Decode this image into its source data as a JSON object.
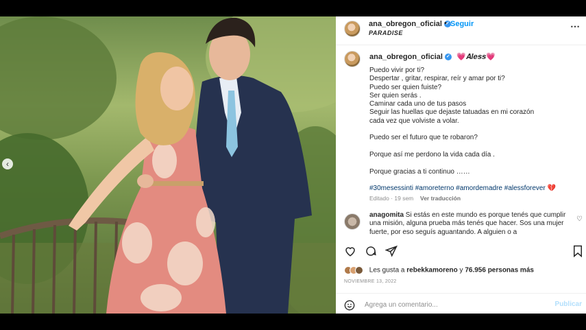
{
  "header": {
    "username": "ana_obregon_oficial",
    "dot": "•",
    "follow_label": "Seguir",
    "location": "PARADISE",
    "more_icon": "⋯"
  },
  "carousel": {
    "prev_icon": "‹"
  },
  "caption": {
    "username": "ana_obregon_oficial",
    "tag": "💗𝑨𝒍𝒆𝒔𝒔💗",
    "lines": [
      "Puedo vivir por ti?",
      "Despertar , gritar, respirar, reír y amar por ti?",
      "Puedo ser quien fuiste?",
      "Ser quien serás .",
      "Caminar cada uno de tus pasos",
      "Seguir las huellas que dejaste tatuadas en mi corazón",
      "cada vez que volviste a volar.",
      "",
      "Puedo ser el futuro que te robaron?",
      "",
      "Porque así me perdono la vida cada día .",
      "",
      "Porque gracias a ti continuo ……"
    ],
    "hashtags": "#30mesessinti #amoreterno #amordemadre #alessforever 💔",
    "edited": "Editado · 19 sem",
    "see_translation": "Ver traducción"
  },
  "comment": {
    "username": "anagomita",
    "text": "Si estás en este mundo es porque tenés que cumplir una misión, alguna prueba más tenés que hacer. Sos una mujer fuerte, por eso seguís aguantando. A alguien o a"
  },
  "likes": {
    "prefix": "Les gusta a",
    "user": "rebekkamoreno",
    "mid": "y",
    "count": "76.956 personas más"
  },
  "date": "NOVIEMBRE 13, 2022",
  "add_comment": {
    "placeholder": "Agrega un comentario...",
    "publish_label": "Publicar"
  },
  "icons": [
    "heart-icon",
    "comment-icon",
    "share-icon",
    "bookmark-icon",
    "emoji-icon"
  ]
}
